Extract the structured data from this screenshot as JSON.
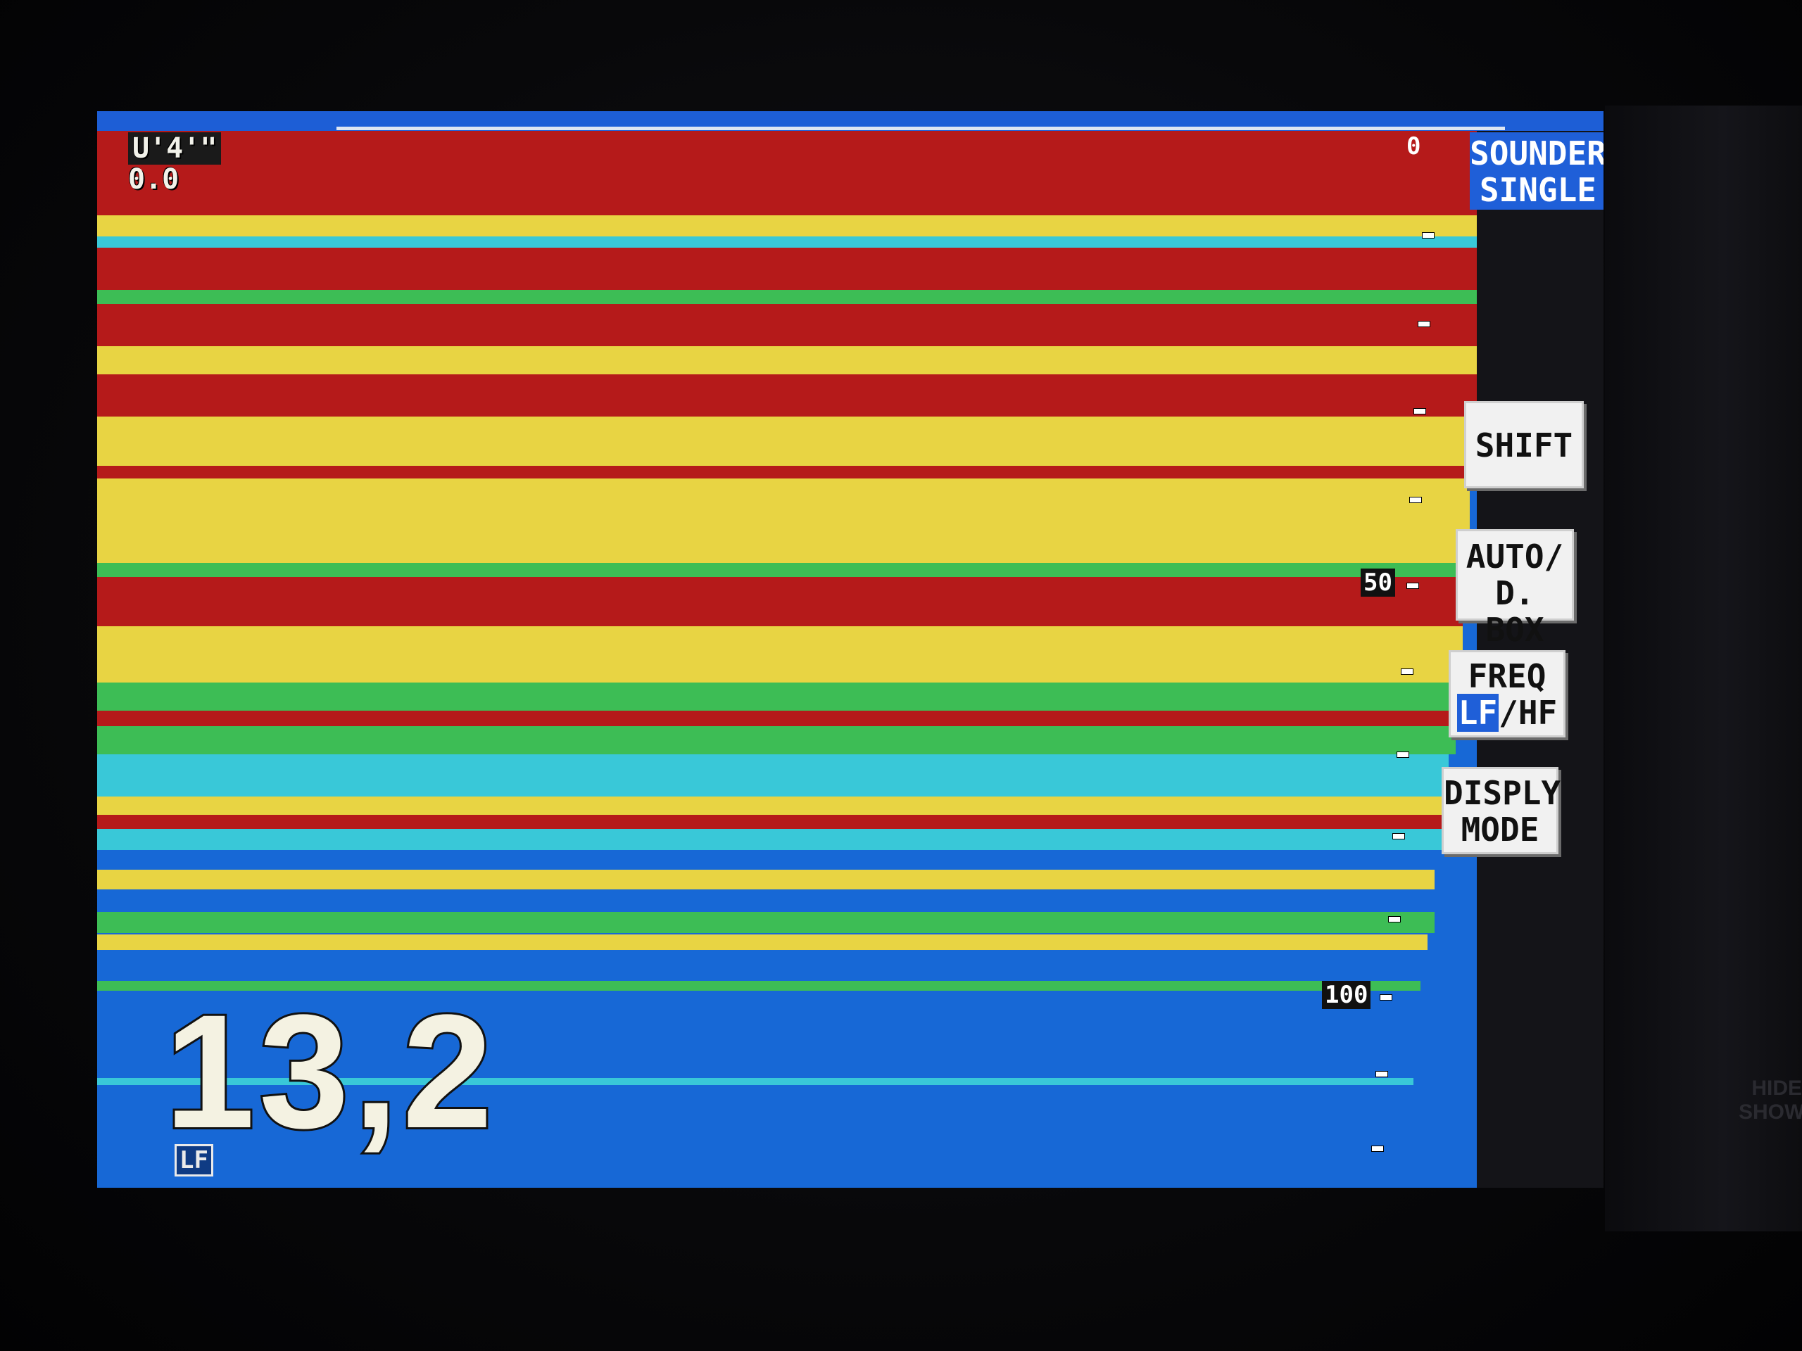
{
  "readout": {
    "line1": "U'4'\"",
    "line2": "0.0"
  },
  "depth": {
    "value": "13,2"
  },
  "frequency_badge": "LF",
  "scale": {
    "top": "0",
    "mid": "50",
    "bottom": "100"
  },
  "mode": {
    "line1": "SOUNDER",
    "line2": "SINGLE"
  },
  "soft_keys": {
    "shift": "SHIFT",
    "auto_line1": "AUTO/",
    "auto_line2": "D. BOX",
    "freq_line1": "FREQ",
    "freq_lf": "LF",
    "freq_hf": "/HF",
    "display_line1": "DISPLY",
    "display_line2": "MODE"
  },
  "bezel": {
    "hide": "HIDE",
    "show": "SHOW"
  },
  "colors": {
    "water": "#1768d6",
    "strong_echo": "#b51a1a",
    "medium_echo": "#e8d443",
    "weak_echo": "#3dbd55",
    "faint_echo": "#39c8d8",
    "accent": "#1f5fd8"
  },
  "echo_bands": [
    {
      "strength": "red"
    },
    {
      "strength": "yellow"
    },
    {
      "strength": "cyan"
    },
    {
      "strength": "red"
    },
    {
      "strength": "green"
    },
    {
      "strength": "red"
    },
    {
      "strength": "yellow"
    },
    {
      "strength": "red"
    },
    {
      "strength": "yellow"
    },
    {
      "strength": "red"
    },
    {
      "strength": "yellow"
    },
    {
      "strength": "green"
    },
    {
      "strength": "red"
    },
    {
      "strength": "red"
    },
    {
      "strength": "yellow"
    },
    {
      "strength": "green"
    },
    {
      "strength": "red"
    },
    {
      "strength": "green"
    },
    {
      "strength": "cyan"
    },
    {
      "strength": "yellow"
    },
    {
      "strength": "red"
    },
    {
      "strength": "cyan"
    },
    {
      "strength": "yellow"
    },
    {
      "strength": "green"
    },
    {
      "strength": "yellow"
    },
    {
      "strength": "green"
    },
    {
      "strength": "cyan"
    }
  ]
}
